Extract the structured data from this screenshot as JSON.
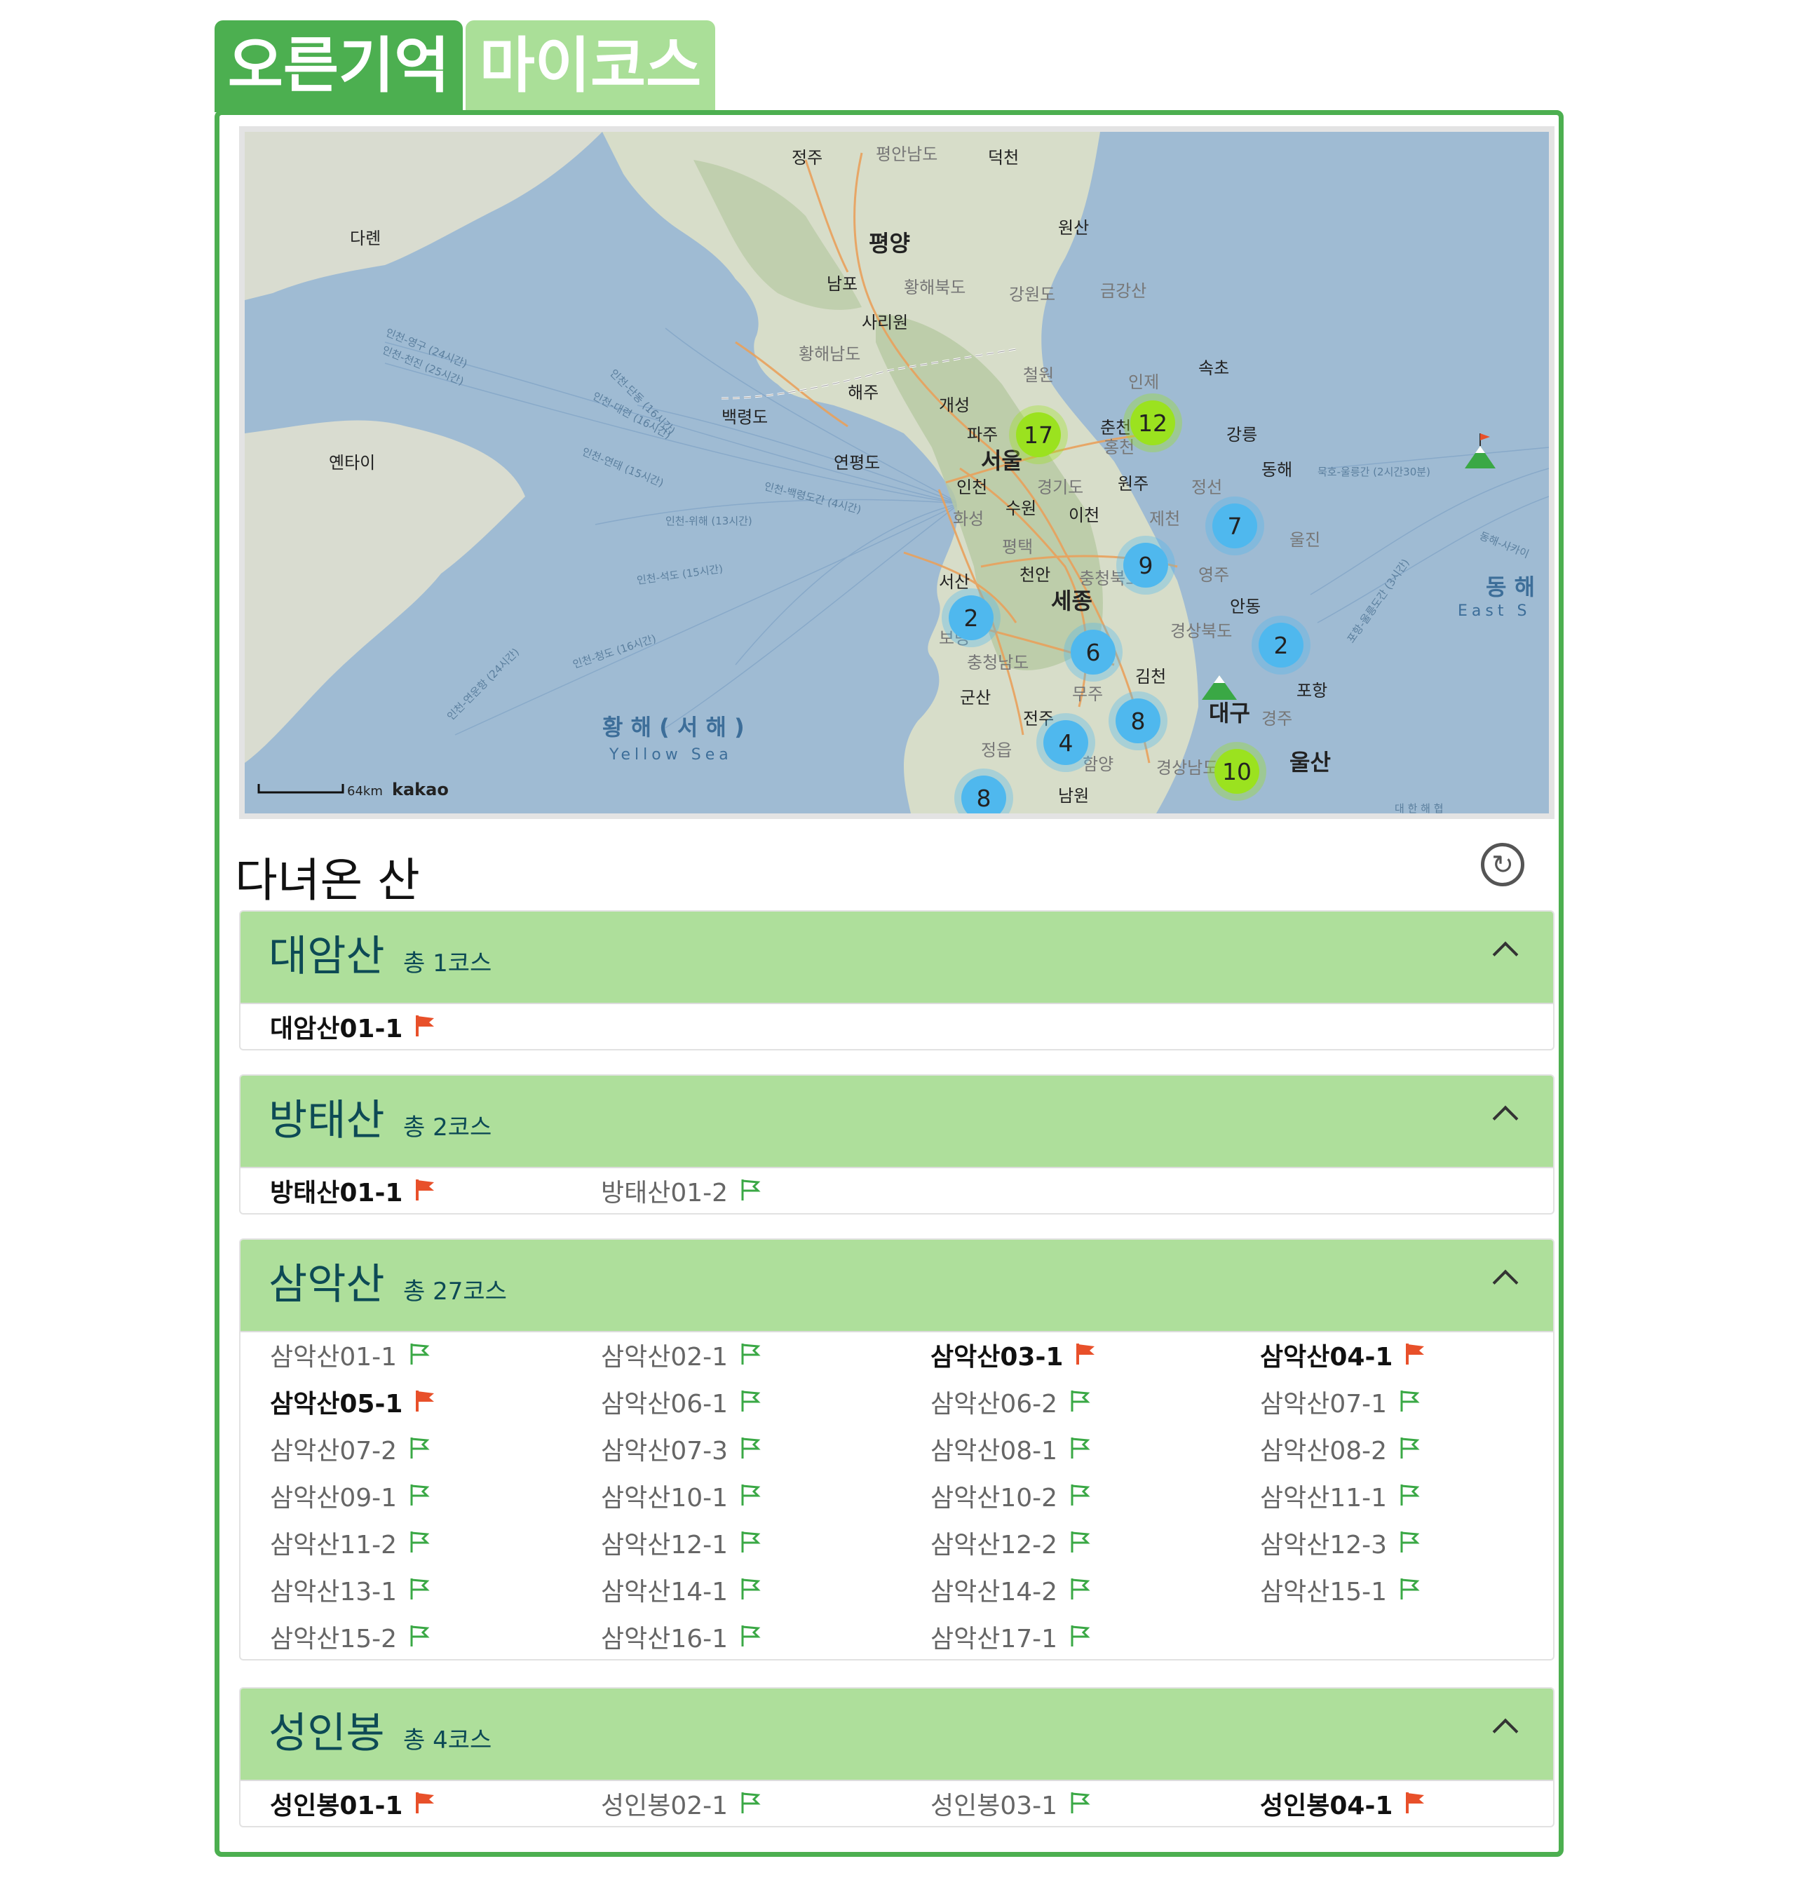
{
  "tabs": [
    {
      "label": "오른기억"
    },
    {
      "label": "마이코스"
    }
  ],
  "map": {
    "scale_label": "64km",
    "provider": "kakao",
    "labels": {
      "jeongju": "정주",
      "pyeongannamdo": "평안남도",
      "deokcheon": "덕천",
      "wonsan": "원산",
      "pyongyang": "평양",
      "dalian": "다롄",
      "nampo": "남포",
      "hwanghaebukdo": "황해북도",
      "gangwondo_n": "강원도",
      "geumgangsan": "금강산",
      "sariwon": "사리원",
      "hwanghaenamdo": "황해남도",
      "sokcho": "속초",
      "cheorwon": "철원",
      "inje": "인제",
      "haeju": "해주",
      "baengnyeongdo": "백령도",
      "kaesong": "개성",
      "yantai": "옌타이",
      "paju": "파주",
      "chuncheon": "춘천",
      "gangneung": "강릉",
      "seoul": "서울",
      "hongcheon": "홍천",
      "donghae": "동해",
      "yeonpyeongdo": "연평도",
      "incheon": "인천",
      "gyeonggido": "경기도",
      "wonju": "원주",
      "jeongseon": "정선",
      "hwaseong": "화성",
      "suwon": "수원",
      "icheon": "이천",
      "jecheon": "제천",
      "uljin": "울진",
      "pyeongtaek": "평택",
      "seosan": "서산",
      "cheonan": "천안",
      "chungcheongbukdo": "충청북도",
      "yeongju": "영주",
      "sejong": "세종",
      "andong": "안동",
      "boryeong": "보령",
      "chungcheongnamdo": "충청남도",
      "gyeongsangbukdo": "경상북도",
      "gimcheon": "김천",
      "gunsan": "군산",
      "muju": "무주",
      "pohang": "포항",
      "jeonju": "전주",
      "daegu": "대구",
      "gyeongju": "경주",
      "jeongeup": "정읍",
      "hamyang": "함양",
      "gyeongsangnamdo": "경상남도",
      "ulsan": "울산",
      "namwon": "남원",
      "yellow_sea": "황 해 ( 서 해 )",
      "yellow_sea_en": "Yellow Sea",
      "east_sea": "동 해",
      "east_sea_en": "East S",
      "daehan_strait": "대 한 해 협"
    },
    "routes": [
      "인천-영구 (24시간)",
      "인천-천진 (25시간)",
      "인천-단동 (16시간)",
      "인천-대련 (16시간)",
      "인천-연태 (15시간)",
      "인천-백령도간 (4시간)",
      "인천-위해 (13시간)",
      "인천-석도 (15시간)",
      "인천-청도 (16시간)",
      "인천-연운항 (24시간)",
      "묵호-울릉간 (2시간30분)",
      "포항-울릉도간 (3시간)",
      "동해-사카이"
    ],
    "clusters": [
      {
        "count": "17",
        "color": "#9be21f"
      },
      {
        "count": "12",
        "color": "#9be21f"
      },
      {
        "count": "7",
        "color": "#4fb8ee"
      },
      {
        "count": "9",
        "color": "#4fb8ee"
      },
      {
        "count": "2",
        "color": "#4fb8ee"
      },
      {
        "count": "6",
        "color": "#4fb8ee"
      },
      {
        "count": "2",
        "color": "#4fb8ee"
      },
      {
        "count": "8",
        "color": "#4fb8ee"
      },
      {
        "count": "4",
        "color": "#4fb8ee"
      },
      {
        "count": "10",
        "color": "#9be21f"
      },
      {
        "count": "8",
        "color": "#4fb8ee"
      }
    ]
  },
  "visited": {
    "title": "다녀온 산",
    "refresh_icon": "refresh-icon",
    "mountains": [
      {
        "name": "대암산",
        "count": "총 1코스",
        "courses": [
          {
            "label": "대암산01-1",
            "done": true
          }
        ]
      },
      {
        "name": "방태산",
        "count": "총 2코스",
        "courses": [
          {
            "label": "방태산01-1",
            "done": true
          },
          {
            "label": "방태산01-2",
            "done": false
          }
        ]
      },
      {
        "name": "삼악산",
        "count": "총 27코스",
        "courses": [
          {
            "label": "삼악산01-1",
            "done": false
          },
          {
            "label": "삼악산02-1",
            "done": false
          },
          {
            "label": "삼악산03-1",
            "done": true
          },
          {
            "label": "삼악산04-1",
            "done": true
          },
          {
            "label": "삼악산05-1",
            "done": true
          },
          {
            "label": "삼악산06-1",
            "done": false
          },
          {
            "label": "삼악산06-2",
            "done": false
          },
          {
            "label": "삼악산07-1",
            "done": false
          },
          {
            "label": "삼악산07-2",
            "done": false
          },
          {
            "label": "삼악산07-3",
            "done": false
          },
          {
            "label": "삼악산08-1",
            "done": false
          },
          {
            "label": "삼악산08-2",
            "done": false
          },
          {
            "label": "삼악산09-1",
            "done": false
          },
          {
            "label": "삼악산10-1",
            "done": false
          },
          {
            "label": "삼악산10-2",
            "done": false
          },
          {
            "label": "삼악산11-1",
            "done": false
          },
          {
            "label": "삼악산11-2",
            "done": false
          },
          {
            "label": "삼악산12-1",
            "done": false
          },
          {
            "label": "삼악산12-2",
            "done": false
          },
          {
            "label": "삼악산12-3",
            "done": false
          },
          {
            "label": "삼악산13-1",
            "done": false
          },
          {
            "label": "삼악산14-1",
            "done": false
          },
          {
            "label": "삼악산14-2",
            "done": false
          },
          {
            "label": "삼악산15-1",
            "done": false
          },
          {
            "label": "삼악산15-2",
            "done": false
          },
          {
            "label": "삼악산16-1",
            "done": false
          },
          {
            "label": "삼악산17-1",
            "done": false
          }
        ]
      },
      {
        "name": "성인봉",
        "count": "총 4코스",
        "courses": [
          {
            "label": "성인봉01-1",
            "done": true
          },
          {
            "label": "성인봉02-1",
            "done": false
          },
          {
            "label": "성인봉03-1",
            "done": false
          },
          {
            "label": "성인봉04-1",
            "done": true
          }
        ]
      }
    ]
  },
  "colors": {
    "primary_green": "#4caf50",
    "light_green": "#aadf98",
    "header_green": "#aedf9b",
    "flag_done": "#e8502a",
    "flag_open": "#3aa845",
    "title_text": "#0d4a55"
  }
}
